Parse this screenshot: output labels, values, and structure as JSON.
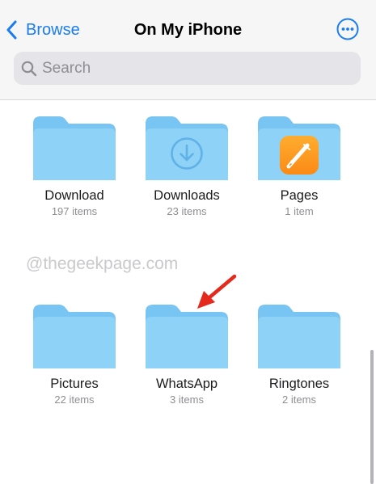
{
  "nav": {
    "back_label": "Browse",
    "title": "On My iPhone"
  },
  "search": {
    "placeholder": "Search"
  },
  "folders": [
    {
      "name": "Download",
      "count": "197 items"
    },
    {
      "name": "Downloads",
      "count": "23 items"
    },
    {
      "name": "Pages",
      "count": "1 item"
    },
    {
      "name": "Pictures",
      "count": "22 items"
    },
    {
      "name": "WhatsApp",
      "count": "3 items"
    },
    {
      "name": "Ringtones",
      "count": "2 items"
    }
  ],
  "watermark": "@thegeekpage.com",
  "colors": {
    "accent": "#1a7cf0",
    "folder": "#8dd1f7",
    "arrow": "#e32a1c"
  }
}
